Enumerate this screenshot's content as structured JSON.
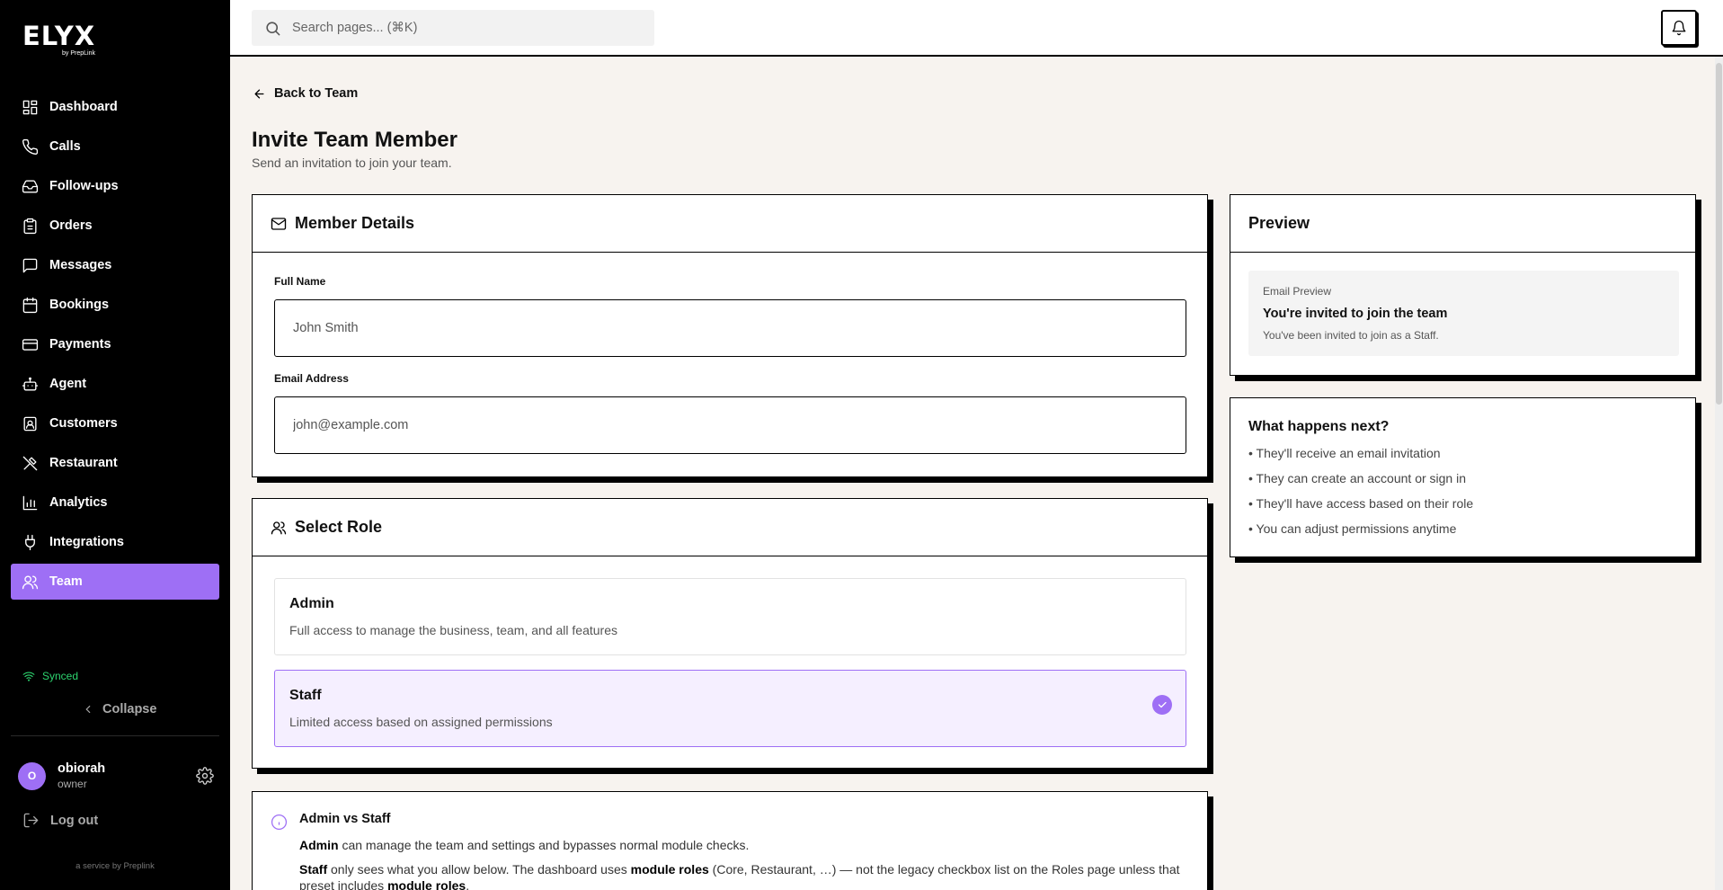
{
  "brand": {
    "name": "ELYX",
    "sub": "by PrepLink"
  },
  "nav": [
    {
      "label": "Dashboard",
      "icon": "dashboard-icon"
    },
    {
      "label": "Calls",
      "icon": "phone-icon"
    },
    {
      "label": "Follow-ups",
      "icon": "inbox-icon"
    },
    {
      "label": "Orders",
      "icon": "clipboard-icon"
    },
    {
      "label": "Messages",
      "icon": "message-icon"
    },
    {
      "label": "Bookings",
      "icon": "calendar-icon"
    },
    {
      "label": "Payments",
      "icon": "credit-card-icon"
    },
    {
      "label": "Agent",
      "icon": "bot-icon"
    },
    {
      "label": "Customers",
      "icon": "contact-icon"
    },
    {
      "label": "Restaurant",
      "icon": "utensils-icon"
    },
    {
      "label": "Analytics",
      "icon": "bar-chart-icon"
    },
    {
      "label": "Integrations",
      "icon": "plug-icon"
    },
    {
      "label": "Team",
      "icon": "users-icon",
      "active": true
    }
  ],
  "sidebar": {
    "synced": "Synced",
    "collapse": "Collapse",
    "user_initial": "O",
    "user_name": "obiorah",
    "user_role": "owner",
    "logout": "Log out",
    "service": "a service by Preplink"
  },
  "search": {
    "placeholder": "Search pages... (⌘K)"
  },
  "page": {
    "back": "Back to Team",
    "title": "Invite Team Member",
    "subtitle": "Send an invitation to join your team."
  },
  "member_details": {
    "title": "Member Details",
    "full_name_label": "Full Name",
    "full_name_placeholder": "John Smith",
    "email_label": "Email Address",
    "email_placeholder": "john@example.com"
  },
  "select_role": {
    "title": "Select Role",
    "roles": [
      {
        "name": "Admin",
        "desc": "Full access to manage the business, team, and all features",
        "selected": false
      },
      {
        "name": "Staff",
        "desc": "Limited access based on assigned permissions",
        "selected": true
      }
    ]
  },
  "admin_vs_staff": {
    "title": "Admin vs Staff",
    "line1_bold": "Admin",
    "line1_rest": " can manage the team and settings and bypasses normal module checks.",
    "line2_bold": "Staff",
    "line2_a": " only sees what you allow below. The dashboard uses ",
    "line2_bold2": "module roles",
    "line2_b": " (Core, Restaurant, …) — not the legacy checkbox list on the Roles page unless that preset includes ",
    "line2_bold3": "module roles",
    "line2_c": "."
  },
  "preview": {
    "title": "Preview",
    "label": "Email Preview",
    "email_title": "You're invited to join the team",
    "email_body": "You've been invited to join as a Staff."
  },
  "next": {
    "title": "What happens next?",
    "items": [
      "• They'll receive an email invitation",
      "• They can create an account or sign in",
      "• They'll have access based on their role",
      "• You can adjust permissions anytime"
    ]
  },
  "colors": {
    "accent": "#9e6ff5",
    "synced": "#2dd46f",
    "background": "#f7f3ef"
  }
}
